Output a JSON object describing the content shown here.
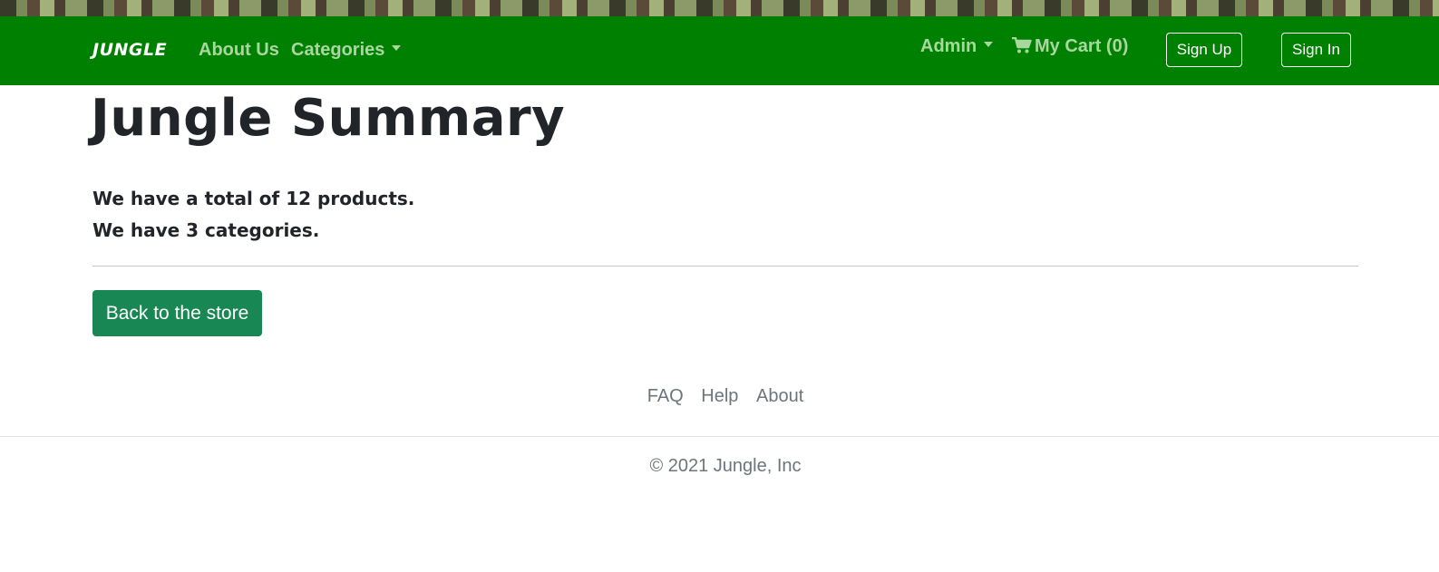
{
  "navbar": {
    "brand": "JUNGLE",
    "about_label": "About Us",
    "categories_label": "Categories",
    "admin_label": "Admin",
    "cart_label": "My Cart (0)",
    "signup_label": "Sign Up",
    "signin_label": "Sign In",
    "background_color": "#008000"
  },
  "main": {
    "title": "Jungle Summary",
    "products_line": "We have a total of 12 products.",
    "categories_line": "We have 3 categories.",
    "back_button_label": "Back to the store",
    "button_color": "#198754"
  },
  "footer": {
    "links": [
      "FAQ",
      "Help",
      "About"
    ],
    "copyright": "© 2021 Jungle, Inc"
  },
  "icons": {
    "cart": "cart-icon",
    "dropdown": "caret-down-icon"
  }
}
